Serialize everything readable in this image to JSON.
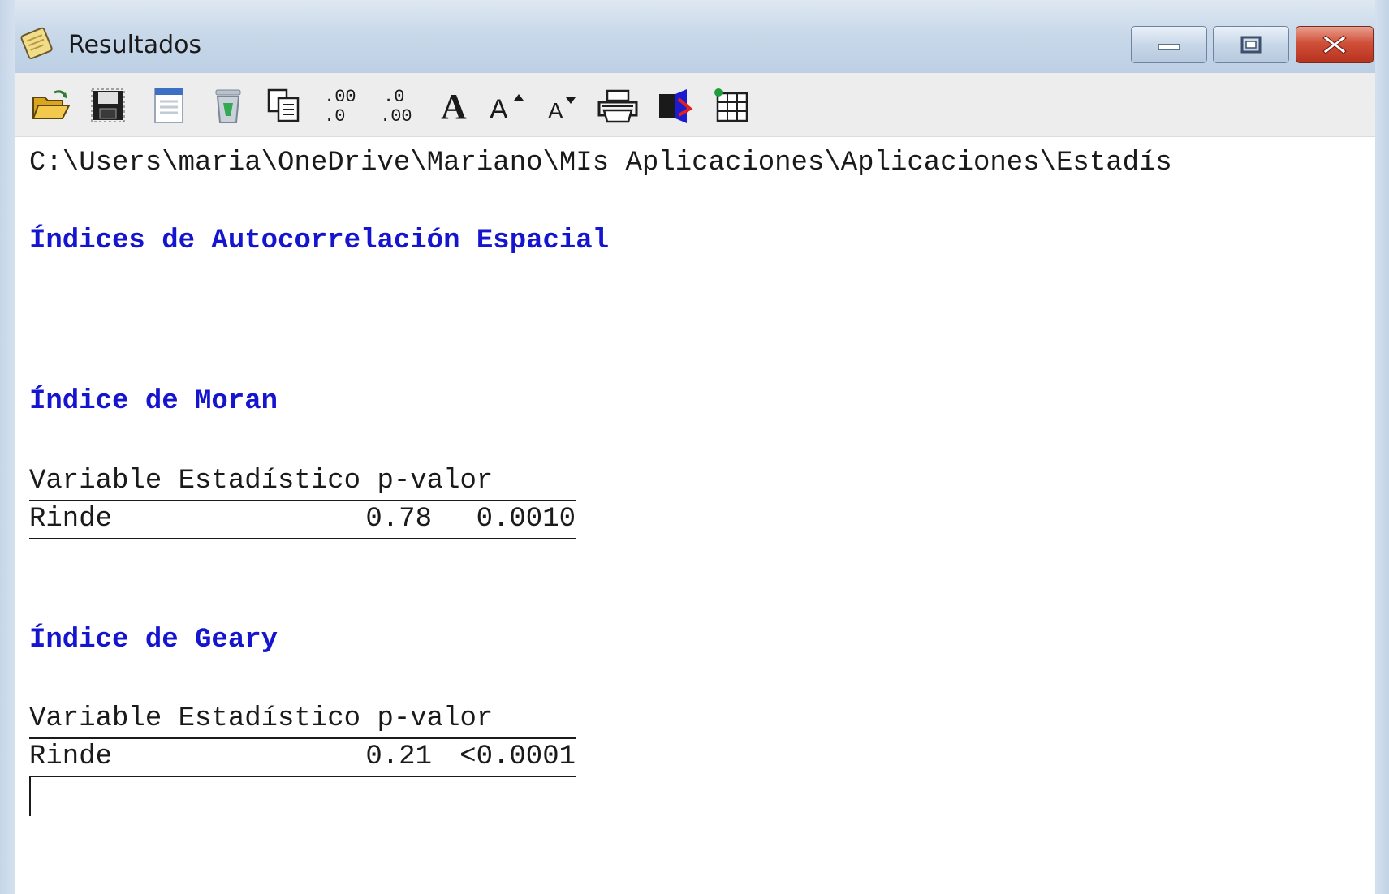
{
  "window": {
    "title": "Resultados",
    "icon": "notepad-scroll-icon",
    "controls": [
      "minimize-icon",
      "maximize-icon",
      "close-icon"
    ]
  },
  "toolbar": {
    "buttons": [
      {
        "name": "open-folder-icon"
      },
      {
        "name": "save-disk-icon"
      },
      {
        "name": "document-icon"
      },
      {
        "name": "recycle-bin-icon"
      },
      {
        "name": "copy-icon"
      },
      {
        "name": "decrease-decimals-icon"
      },
      {
        "name": "increase-decimals-icon"
      },
      {
        "name": "bold-font-icon"
      },
      {
        "name": "increase-font-size-icon"
      },
      {
        "name": "decrease-font-size-icon"
      },
      {
        "name": "print-icon"
      },
      {
        "name": "exit-door-icon"
      },
      {
        "name": "table-grid-icon"
      }
    ],
    "decrease_decimals_glyph": ".00\n.0",
    "increase_decimals_glyph": ".0\n.00",
    "bold_glyph": "A",
    "font_up_glyph": "A",
    "font_down_glyph": "A"
  },
  "content": {
    "path": "C:\\Users\\maria\\OneDrive\\Mariano\\MIs Aplicaciones\\Aplicaciones\\Estadís",
    "main_title": "Índices de Autocorrelación Espacial",
    "sections": [
      {
        "title": "Índice de Moran",
        "header": "Variable Estadístico p-valor",
        "rows": [
          {
            "variable": "Rinde",
            "estadistico": "0.78",
            "p_valor": "0.0010"
          }
        ]
      },
      {
        "title": "Índice de Geary",
        "header": "Variable Estadístico p-valor",
        "rows": [
          {
            "variable": "Rinde",
            "estadistico": "0.21",
            "p_valor": "<0.0001"
          }
        ]
      }
    ]
  },
  "colors": {
    "heading": "#1515d0",
    "text": "#1a1a1a",
    "toolbar_bg": "#ededed",
    "close_button": "#c8412b"
  }
}
